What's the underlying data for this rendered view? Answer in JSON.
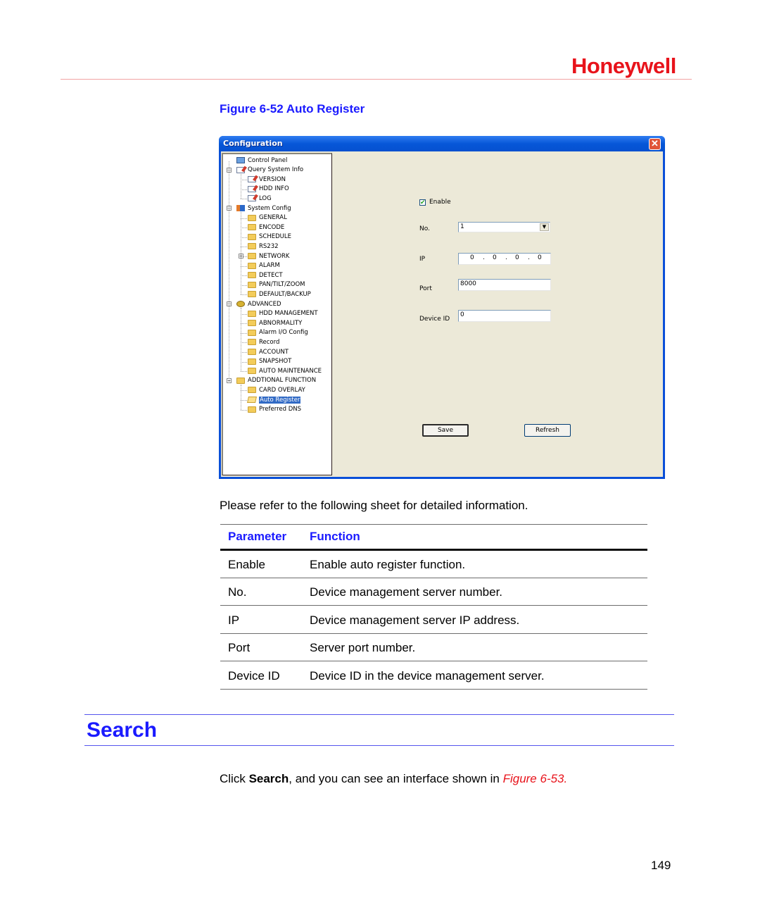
{
  "header": {
    "brand": "Honeywell",
    "brand_color": "#e8131b"
  },
  "figure": {
    "caption": "Figure 6-52 Auto Register",
    "window": {
      "title": "Configuration",
      "close_icon": "close-icon",
      "tree": [
        {
          "label": "Control Panel",
          "icon": "monitor-icon",
          "level": 0
        },
        {
          "label": "Query System Info",
          "icon": "notepad-icon",
          "level": 0,
          "expander": "−"
        },
        {
          "label": "VERSION",
          "icon": "notepad-icon",
          "level": 1
        },
        {
          "label": "HDD INFO",
          "icon": "notepad-icon",
          "level": 1
        },
        {
          "label": "LOG",
          "icon": "notepad-icon",
          "level": 1
        },
        {
          "label": "System Config",
          "icon": "tools-icon",
          "level": 0,
          "expander": "−"
        },
        {
          "label": "GENERAL",
          "icon": "folder-icon",
          "level": 1
        },
        {
          "label": "ENCODE",
          "icon": "folder-icon",
          "level": 1
        },
        {
          "label": "SCHEDULE",
          "icon": "folder-icon",
          "level": 1
        },
        {
          "label": "RS232",
          "icon": "folder-icon",
          "level": 1
        },
        {
          "label": "NETWORK",
          "icon": "folder-icon",
          "level": 1,
          "expander": "+"
        },
        {
          "label": "ALARM",
          "icon": "folder-icon",
          "level": 1
        },
        {
          "label": "DETECT",
          "icon": "folder-icon",
          "level": 1
        },
        {
          "label": "PAN/TILT/ZOOM",
          "icon": "folder-icon",
          "level": 1
        },
        {
          "label": "DEFAULT/BACKUP",
          "icon": "folder-icon",
          "level": 1
        },
        {
          "label": "ADVANCED",
          "icon": "gears-icon",
          "level": 0,
          "expander": "−"
        },
        {
          "label": "HDD MANAGEMENT",
          "icon": "folder-icon",
          "level": 1
        },
        {
          "label": "ABNORMALITY",
          "icon": "folder-icon",
          "level": 1
        },
        {
          "label": "Alarm I/O Config",
          "icon": "folder-icon",
          "level": 1
        },
        {
          "label": "Record",
          "icon": "folder-icon",
          "level": 1
        },
        {
          "label": "ACCOUNT",
          "icon": "folder-icon",
          "level": 1
        },
        {
          "label": "SNAPSHOT",
          "icon": "folder-icon",
          "level": 1
        },
        {
          "label": "AUTO MAINTENANCE",
          "icon": "folder-icon",
          "level": 1
        },
        {
          "label": "ADDTIONAL FUNCTION",
          "icon": "folder-icon",
          "level": 0,
          "expander": "−"
        },
        {
          "label": "CARD OVERLAY",
          "icon": "folder-icon",
          "level": 1
        },
        {
          "label": "Auto Register",
          "icon": "folder-open-icon",
          "level": 1,
          "selected": true
        },
        {
          "label": "Preferred DNS",
          "icon": "folder-icon",
          "level": 1
        }
      ],
      "form": {
        "enable_label": "Enable",
        "enable_checked": true,
        "no_label": "No.",
        "no_value": "1",
        "ip_label": "IP",
        "ip_value": [
          "0",
          "0",
          "0",
          "0"
        ],
        "port_label": "Port",
        "port_value": "8000",
        "device_id_label": "Device ID",
        "device_id_value": "0",
        "save_label": "Save",
        "refresh_label": "Refresh"
      }
    }
  },
  "intro": "Please refer to the following sheet for detailed information.",
  "table": {
    "headers": [
      "Parameter",
      "Function"
    ],
    "rows": [
      [
        "Enable",
        "Enable auto register function."
      ],
      [
        "No.",
        "Device management server number."
      ],
      [
        "IP",
        "Device management server IP address."
      ],
      [
        "Port",
        "Server port number."
      ],
      [
        "Device ID",
        "Device ID in the device management server."
      ]
    ]
  },
  "section": {
    "title": "Search",
    "text_before": "Click ",
    "text_bold": "Search",
    "text_middle": ", and you can see an interface shown in ",
    "text_ref": "Figure 6-53."
  },
  "page_number": "149"
}
